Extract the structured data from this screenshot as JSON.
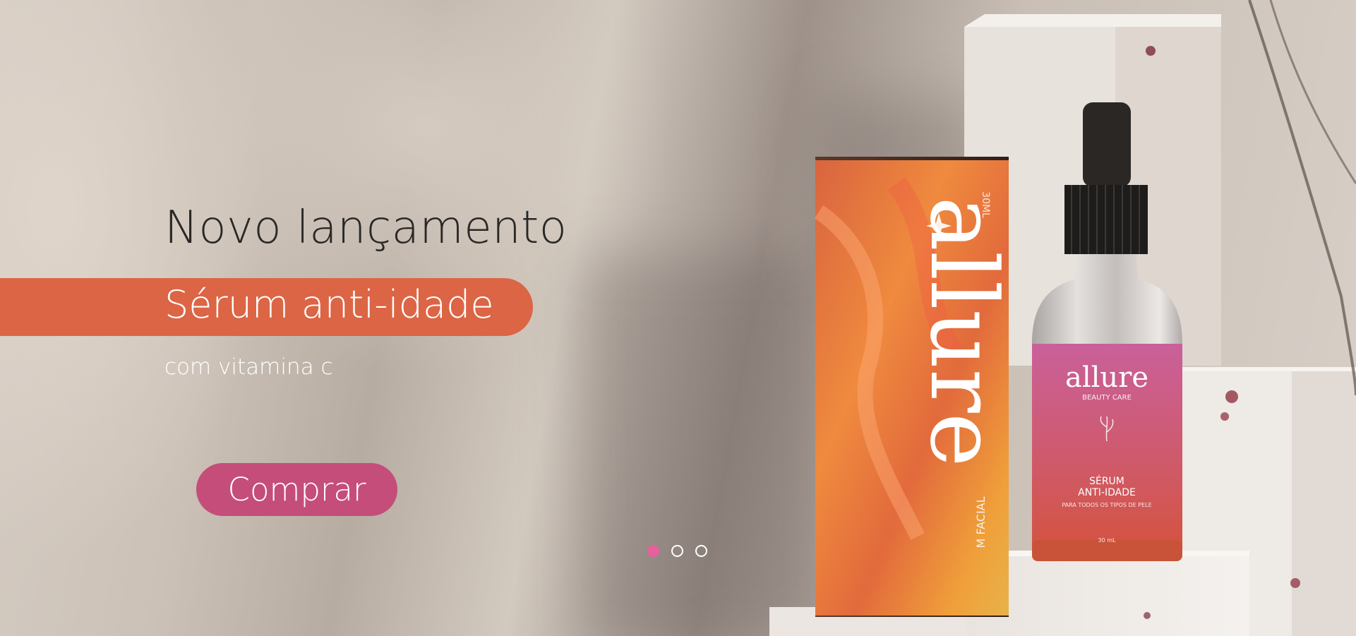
{
  "hero": {
    "title": "Novo lançamento",
    "product_name": "Sérum anti-idade",
    "subtitle": "com vitamina c",
    "button_label": "Comprar"
  },
  "carousel": {
    "total_slides": 3,
    "active_slide": 1
  },
  "packaging": {
    "box_brand": "allure",
    "box_volume": "30ML",
    "box_type": "M FACIAL",
    "bottle_brand": "allure",
    "bottle_tagline": "BEAUTY CARE",
    "bottle_product_line1": "SÉRUM",
    "bottle_product_line2": "ANTI-IDADE",
    "bottle_skin": "PARA TODOS OS TIPOS DE PELE",
    "bottle_volume": "30 mL"
  },
  "colors": {
    "pill": "#dc6545",
    "button": "#c54d7a",
    "dot_active": "#e6609f"
  }
}
